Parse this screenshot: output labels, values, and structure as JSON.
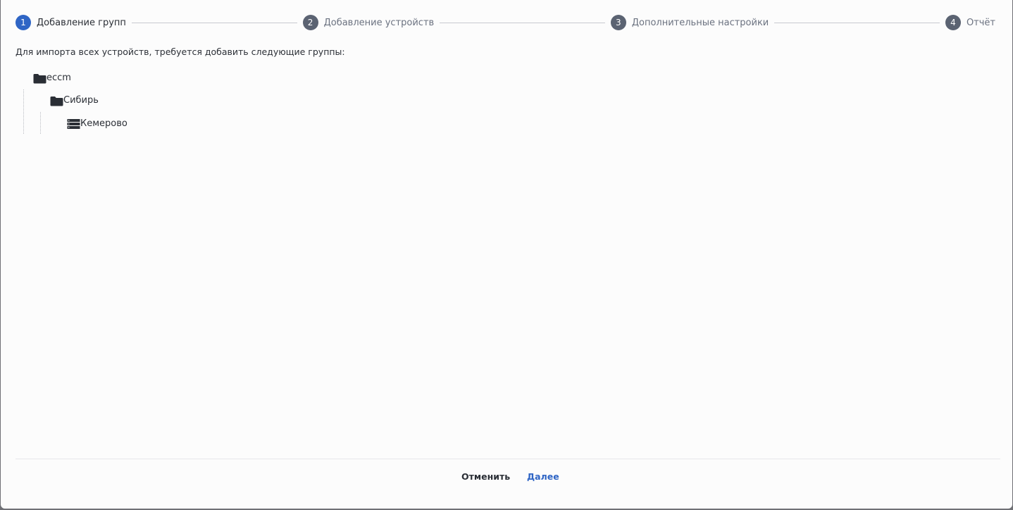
{
  "stepper": {
    "steps": [
      {
        "number": "1",
        "label": "Добавление групп",
        "active": true
      },
      {
        "number": "2",
        "label": "Добавление устройств",
        "active": false
      },
      {
        "number": "3",
        "label": "Дополнительные настройки",
        "active": false
      },
      {
        "number": "4",
        "label": "Отчёт",
        "active": false
      }
    ]
  },
  "intro_text": "Для импорта всех устройств, требуется добавить следующие группы:",
  "tree": {
    "root": {
      "label": "eccm",
      "icon": "folder-icon"
    },
    "child": {
      "label": "Сибирь",
      "icon": "folder-icon"
    },
    "leaf": {
      "label": "Кемерово",
      "icon": "server-list-icon"
    }
  },
  "footer": {
    "cancel_label": "Отменить",
    "next_label": "Далее"
  },
  "colors": {
    "accent": "#2f65c5",
    "step_inactive": "#5b6372",
    "text": "#2b2f36",
    "muted_text": "#6b7280"
  }
}
